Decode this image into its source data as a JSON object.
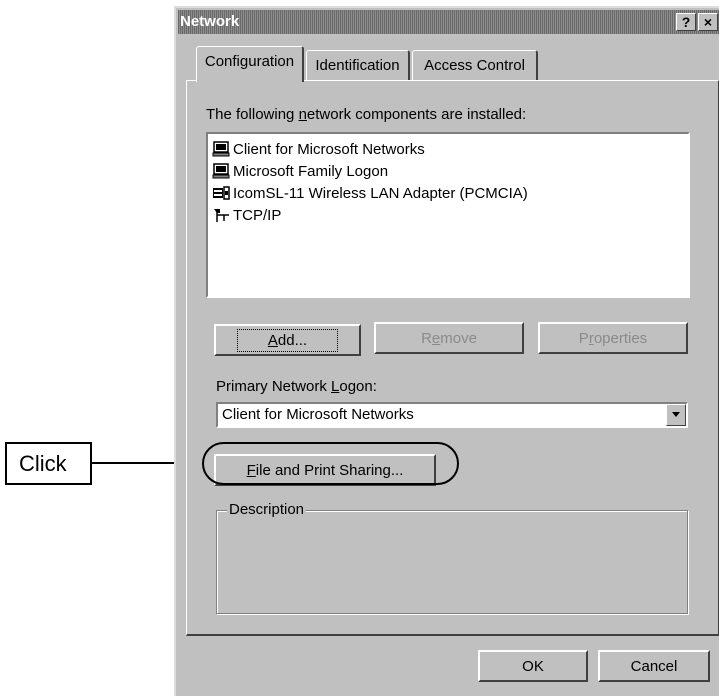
{
  "annotation": {
    "label": "Click"
  },
  "window": {
    "title": "Network",
    "help_btn": "?",
    "close_btn": "×"
  },
  "tabs": [
    {
      "label": "Configuration",
      "active": true
    },
    {
      "label": "Identification",
      "active": false
    },
    {
      "label": "Access Control",
      "active": false
    }
  ],
  "components": {
    "label_pre": "The following ",
    "label_u": "n",
    "label_post": "etwork components are installed:",
    "items": [
      {
        "icon": "client-computer-icon",
        "label": "Client for Microsoft Networks"
      },
      {
        "icon": "client-computer-icon",
        "label": "Microsoft Family Logon"
      },
      {
        "icon": "network-adapter-icon",
        "label": "IcomSL-11 Wireless LAN Adapter (PCMCIA)"
      },
      {
        "icon": "protocol-icon",
        "label": "TCP/IP"
      }
    ]
  },
  "buttons": {
    "add_u": "A",
    "add_rest": "dd...",
    "remove_pre": "R",
    "remove_u": "e",
    "remove_rest": "move",
    "properties_pre": "P",
    "properties_u": "r",
    "properties_rest": "operties",
    "file_print_u": "F",
    "file_print_rest": "ile and Print Sharing...",
    "ok": "OK",
    "cancel": "Cancel"
  },
  "logon": {
    "label_pre": "Primary Network ",
    "label_u": "L",
    "label_post": "ogon:",
    "selected": "Client for Microsoft Networks"
  },
  "description": {
    "label": "Description"
  }
}
